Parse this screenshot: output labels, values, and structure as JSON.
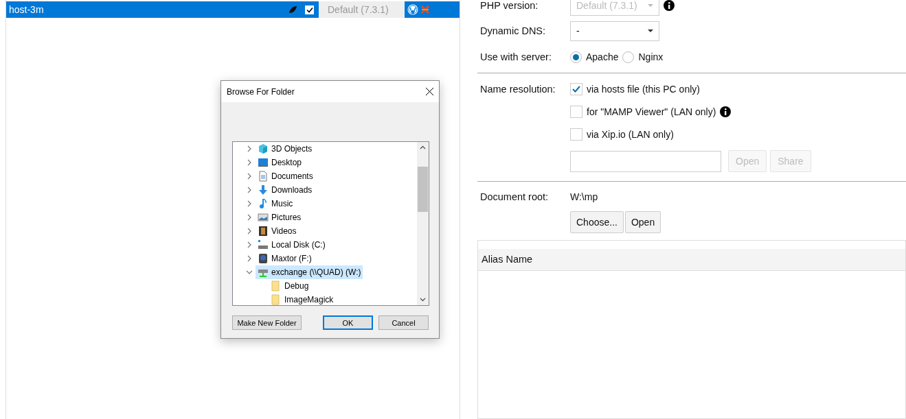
{
  "host_list": {
    "rows": [
      {
        "name": "host-3m",
        "selected": true,
        "checked": true,
        "php_version": "Default (7.3.1)"
      }
    ]
  },
  "settings": {
    "php_version": {
      "label": "PHP version:",
      "value": "Default (7.3.1)",
      "disabled": true
    },
    "dynamic_dns": {
      "label": "Dynamic DNS:",
      "value": "-"
    },
    "server": {
      "label": "Use with server:",
      "options": [
        {
          "label": "Apache",
          "selected": true
        },
        {
          "label": "Nginx",
          "selected": false
        }
      ]
    },
    "name_resolution": {
      "label": "Name resolution:",
      "options": [
        {
          "label": "via hosts file (this PC only)",
          "checked": true,
          "info": false
        },
        {
          "label": "for \"MAMP Viewer\" (LAN only)",
          "checked": false,
          "info": true
        },
        {
          "label": "via Xip.io (LAN only)",
          "checked": false,
          "info": false
        }
      ],
      "buttons": [
        {
          "label": "Open",
          "disabled": true
        },
        {
          "label": "Share",
          "disabled": true
        }
      ]
    },
    "document_root": {
      "label": "Document root:",
      "value": "W:\\mp",
      "buttons": [
        {
          "label": "Choose...",
          "disabled": false
        },
        {
          "label": "Open",
          "disabled": false
        }
      ]
    },
    "alias_table": {
      "columns": [
        "Alias Name"
      ]
    }
  },
  "dialog": {
    "title": "Browse For Folder",
    "tree": [
      {
        "label": "3D Objects",
        "kind": "objects",
        "expanded": false,
        "selected": false
      },
      {
        "label": "Desktop",
        "kind": "desktop",
        "expanded": false,
        "selected": false
      },
      {
        "label": "Documents",
        "kind": "documents",
        "expanded": false,
        "selected": false
      },
      {
        "label": "Downloads",
        "kind": "downloads",
        "expanded": false,
        "selected": false
      },
      {
        "label": "Music",
        "kind": "music",
        "expanded": false,
        "selected": false
      },
      {
        "label": "Pictures",
        "kind": "pictures",
        "expanded": false,
        "selected": false
      },
      {
        "label": "Videos",
        "kind": "videos",
        "expanded": false,
        "selected": false
      },
      {
        "label": "Local Disk (C:)",
        "kind": "disk",
        "expanded": false,
        "selected": false
      },
      {
        "label": "Maxtor (F:)",
        "kind": "drive",
        "expanded": false,
        "selected": false
      },
      {
        "label": "exchange (\\\\QUAD) (W:)",
        "kind": "network",
        "expanded": true,
        "selected": true,
        "children": [
          {
            "label": "Debug",
            "kind": "folder",
            "selected": false
          },
          {
            "label": "ImageMagick",
            "kind": "folder",
            "selected": false
          }
        ]
      }
    ],
    "buttons": [
      {
        "label": "Make New Folder",
        "default": false
      },
      {
        "label": "OK",
        "default": true
      },
      {
        "label": "Cancel",
        "default": false
      }
    ]
  }
}
